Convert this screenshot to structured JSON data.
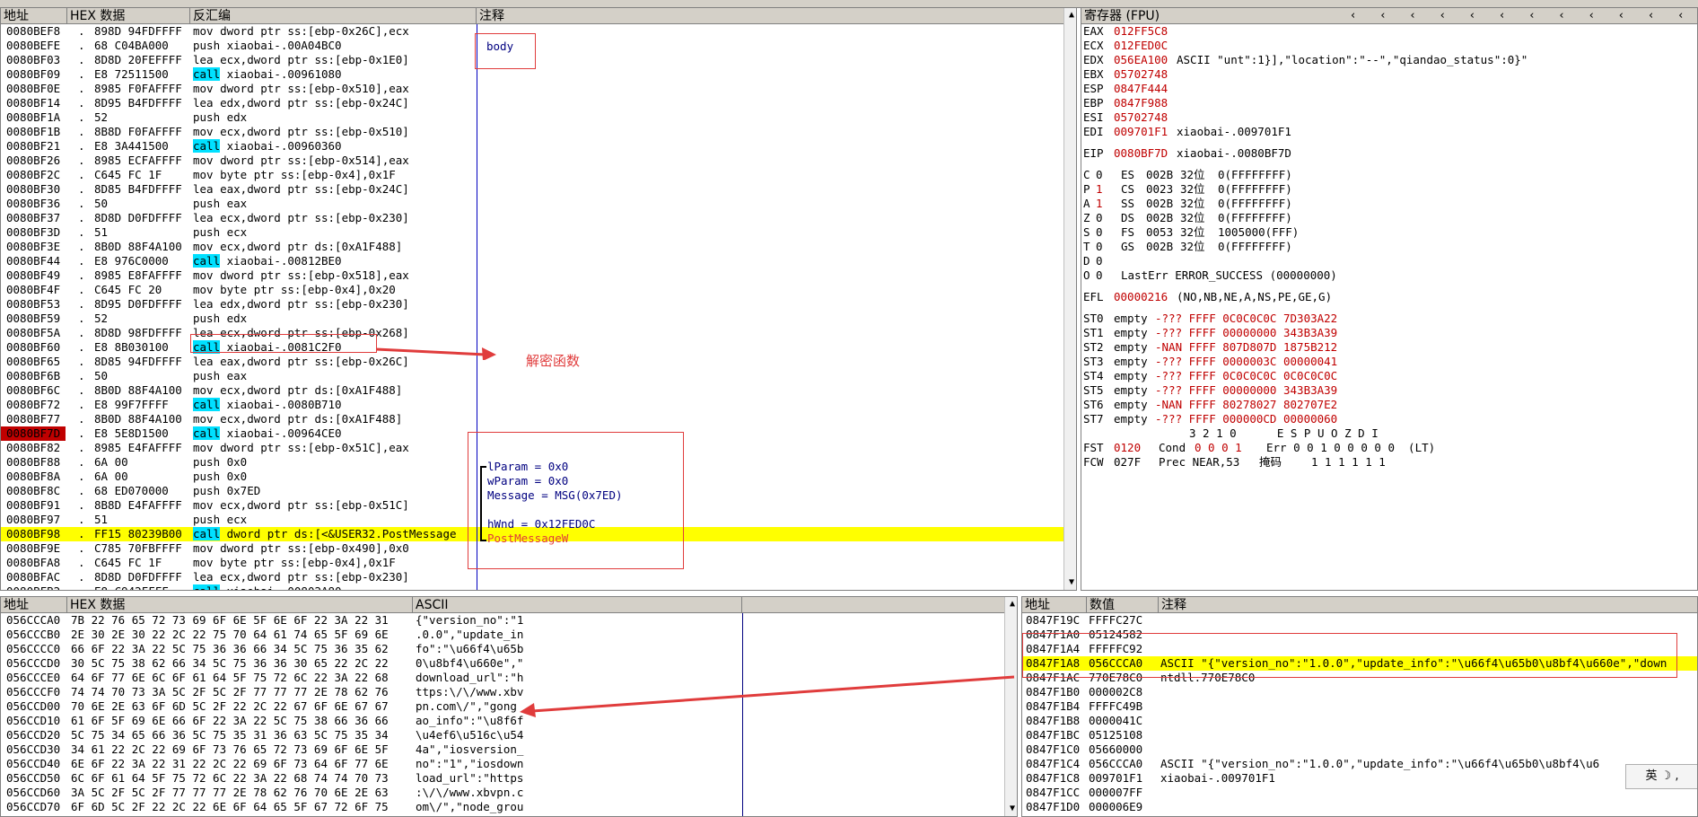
{
  "disasm": {
    "headers": {
      "addr": "地址",
      "hex": "HEX 数据",
      "asm": "反汇编",
      "comment": "注释"
    },
    "rows": [
      {
        "addr": "0080BEF8",
        "mark": ".",
        "hex": "898D 94FDFFFF",
        "asm": "mov dword ptr ss:[ebp-0x26C],ecx"
      },
      {
        "addr": "0080BEFE",
        "mark": ".",
        "hex": "68 C04BA000",
        "asm": "push xiaobai-.00A04BC0"
      },
      {
        "addr": "0080BF03",
        "mark": ".",
        "hex": "8D8D 20FEFFFF",
        "asm": "lea ecx,dword ptr ss:[ebp-0x1E0]"
      },
      {
        "addr": "0080BF09",
        "mark": ".",
        "hex": "E8 72511500",
        "asm": "call xiaobai-.00961080"
      },
      {
        "addr": "0080BF0E",
        "mark": ".",
        "hex": "8985 F0FAFFFF",
        "asm": "mov dword ptr ss:[ebp-0x510],eax"
      },
      {
        "addr": "0080BF14",
        "mark": ".",
        "hex": "8D95 B4FDFFFF",
        "asm": "lea edx,dword ptr ss:[ebp-0x24C]"
      },
      {
        "addr": "0080BF1A",
        "mark": ".",
        "hex": "52",
        "asm": "push edx"
      },
      {
        "addr": "0080BF1B",
        "mark": ".",
        "hex": "8B8D F0FAFFFF",
        "asm": "mov ecx,dword ptr ss:[ebp-0x510]"
      },
      {
        "addr": "0080BF21",
        "mark": ".",
        "hex": "E8 3A441500",
        "asm": "call xiaobai-.00960360"
      },
      {
        "addr": "0080BF26",
        "mark": ".",
        "hex": "8985 ECFAFFFF",
        "asm": "mov dword ptr ss:[ebp-0x514],eax"
      },
      {
        "addr": "0080BF2C",
        "mark": ".",
        "hex": "C645 FC 1F",
        "asm": "mov byte ptr ss:[ebp-0x4],0x1F"
      },
      {
        "addr": "0080BF30",
        "mark": ".",
        "hex": "8D85 B4FDFFFF",
        "asm": "lea eax,dword ptr ss:[ebp-0x24C]"
      },
      {
        "addr": "0080BF36",
        "mark": ".",
        "hex": "50",
        "asm": "push eax"
      },
      {
        "addr": "0080BF37",
        "mark": ".",
        "hex": "8D8D D0FDFFFF",
        "asm": "lea ecx,dword ptr ss:[ebp-0x230]"
      },
      {
        "addr": "0080BF3D",
        "mark": ".",
        "hex": "51",
        "asm": "push ecx"
      },
      {
        "addr": "0080BF3E",
        "mark": ".",
        "hex": "8B0D 88F4A100",
        "asm": "mov ecx,dword ptr ds:[0xA1F488]"
      },
      {
        "addr": "0080BF44",
        "mark": ".",
        "hex": "E8 976C0000",
        "asm": "call xiaobai-.00812BE0"
      },
      {
        "addr": "0080BF49",
        "mark": ".",
        "hex": "8985 E8FAFFFF",
        "asm": "mov dword ptr ss:[ebp-0x518],eax"
      },
      {
        "addr": "0080BF4F",
        "mark": ".",
        "hex": "C645 FC 20",
        "asm": "mov byte ptr ss:[ebp-0x4],0x20"
      },
      {
        "addr": "0080BF53",
        "mark": ".",
        "hex": "8D95 D0FDFFFF",
        "asm": "lea edx,dword ptr ss:[ebp-0x230]"
      },
      {
        "addr": "0080BF59",
        "mark": ".",
        "hex": "52",
        "asm": "push edx"
      },
      {
        "addr": "0080BF5A",
        "mark": ".",
        "hex": "8D8D 98FDFFFF",
        "asm": "lea ecx,dword ptr ss:[ebp-0x268]"
      },
      {
        "addr": "0080BF60",
        "mark": ".",
        "hex": "E8 8B030100",
        "asm": "call xiaobai-.0081C2F0"
      },
      {
        "addr": "0080BF65",
        "mark": ".",
        "hex": "8D85 94FDFFFF",
        "asm": "lea eax,dword ptr ss:[ebp-0x26C]"
      },
      {
        "addr": "0080BF6B",
        "mark": ".",
        "hex": "50",
        "asm": "push eax"
      },
      {
        "addr": "0080BF6C",
        "mark": ".",
        "hex": "8B0D 88F4A100",
        "asm": "mov ecx,dword ptr ds:[0xA1F488]"
      },
      {
        "addr": "0080BF72",
        "mark": ".",
        "hex": "E8 99F7FFFF",
        "asm": "call xiaobai-.0080B710"
      },
      {
        "addr": "0080BF77",
        "mark": ".",
        "hex": "8B0D 88F4A100",
        "asm": "mov ecx,dword ptr ds:[0xA1F488]"
      },
      {
        "addr": "0080BF7D",
        "mark": ".",
        "hex": "E8 5E8D1500",
        "asm": "call xiaobai-.00964CE0"
      },
      {
        "addr": "0080BF82",
        "mark": ".",
        "hex": "8985 E4FAFFFF",
        "asm": "mov dword ptr ss:[ebp-0x51C],eax"
      },
      {
        "addr": "0080BF88",
        "mark": ".",
        "hex": "6A 00",
        "asm": "push 0x0"
      },
      {
        "addr": "0080BF8A",
        "mark": ".",
        "hex": "6A 00",
        "asm": "push 0x0"
      },
      {
        "addr": "0080BF8C",
        "mark": ".",
        "hex": "68 ED070000",
        "asm": "push 0x7ED"
      },
      {
        "addr": "0080BF91",
        "mark": ".",
        "hex": "8B8D E4FAFFFF",
        "asm": "mov ecx,dword ptr ss:[ebp-0x51C]"
      },
      {
        "addr": "0080BF97",
        "mark": ".",
        "hex": "51",
        "asm": "push ecx"
      },
      {
        "addr": "0080BF98",
        "mark": ".",
        "hex": "FF15 80239B00",
        "asm": "call dword ptr ds:[<&USER32.PostMessage"
      },
      {
        "addr": "0080BF9E",
        "mark": ".",
        "hex": "C785 70FBFFFF",
        "asm": "mov dword ptr ss:[ebp-0x490],0x0"
      },
      {
        "addr": "0080BFA8",
        "mark": ".",
        "hex": "C645 FC 1F",
        "asm": "mov byte ptr ss:[ebp-0x4],0x1F"
      },
      {
        "addr": "0080BFAC",
        "mark": ".",
        "hex": "8D8D D0FDFFFF",
        "asm": "lea ecx,dword ptr ss:[ebp-0x230]"
      },
      {
        "addr": "0080BFB2",
        "mark": ".",
        "hex": "E8 C942FFFF",
        "asm": "call xiaobai-.00802A80"
      }
    ],
    "comments": {
      "body": "body",
      "lparam": "lParam = 0x0",
      "wparam": "wParam = 0x0",
      "message": "Message = MSG(0x7ED)",
      "hwnd": "hWnd = 0x12FED0C",
      "postmessage": "PostMessageW"
    },
    "annotation": "解密函数"
  },
  "registers": {
    "header": "寄存器 (FPU)",
    "gp": [
      {
        "name": "EAX",
        "val": "012FF5C8",
        "note": ""
      },
      {
        "name": "ECX",
        "val": "012FED0C",
        "note": ""
      },
      {
        "name": "EDX",
        "val": "056EA100",
        "note": "ASCII \"unt\":1}],\"location\":\"--\",\"qiandao_status\":0}\""
      },
      {
        "name": "EBX",
        "val": "05702748",
        "note": ""
      },
      {
        "name": "ESP",
        "val": "0847F444",
        "note": ""
      },
      {
        "name": "EBP",
        "val": "0847F988",
        "note": ""
      },
      {
        "name": "ESI",
        "val": "05702748",
        "note": ""
      },
      {
        "name": "EDI",
        "val": "009701F1",
        "note": "xiaobai-.009701F1"
      }
    ],
    "eip": {
      "name": "EIP",
      "val": "0080BF7D",
      "note": "xiaobai-.0080BF7D"
    },
    "flags": [
      {
        "f": "C",
        "v": "0",
        "seg": "ES",
        "sv": "002B",
        "bits": "32位",
        "rest": "0(FFFFFFFF)"
      },
      {
        "f": "P",
        "v": "1",
        "seg": "CS",
        "sv": "0023",
        "bits": "32位",
        "rest": "0(FFFFFFFF)"
      },
      {
        "f": "A",
        "v": "1",
        "seg": "SS",
        "sv": "002B",
        "bits": "32位",
        "rest": "0(FFFFFFFF)"
      },
      {
        "f": "Z",
        "v": "0",
        "seg": "DS",
        "sv": "002B",
        "bits": "32位",
        "rest": "0(FFFFFFFF)"
      },
      {
        "f": "S",
        "v": "0",
        "seg": "FS",
        "sv": "0053",
        "bits": "32位",
        "rest": "1005000(FFF)"
      },
      {
        "f": "T",
        "v": "0",
        "seg": "GS",
        "sv": "002B",
        "bits": "32位",
        "rest": "0(FFFFFFFF)"
      },
      {
        "f": "D",
        "v": "0",
        "seg": "",
        "sv": "",
        "bits": "",
        "rest": ""
      },
      {
        "f": "O",
        "v": "0",
        "seg": "",
        "sv": "",
        "bits": "",
        "rest": "LastErr ERROR_SUCCESS (00000000)"
      }
    ],
    "efl": {
      "name": "EFL",
      "val": "00000216",
      "note": "(NO,NB,NE,A,NS,PE,GE,G)"
    },
    "st": [
      {
        "name": "ST0",
        "tag": "empty",
        "v": "-??? FFFF 0C0C0C0C 7D303A22"
      },
      {
        "name": "ST1",
        "tag": "empty",
        "v": "-??? FFFF 00000000 343B3A39"
      },
      {
        "name": "ST2",
        "tag": "empty",
        "v": "-NAN FFFF 807D807D 1875B212"
      },
      {
        "name": "ST3",
        "tag": "empty",
        "v": "-??? FFFF 0000003C 00000041"
      },
      {
        "name": "ST4",
        "tag": "empty",
        "v": "-??? FFFF 0C0C0C0C 0C0C0C0C"
      },
      {
        "name": "ST5",
        "tag": "empty",
        "v": "-??? FFFF 00000000 343B3A39"
      },
      {
        "name": "ST6",
        "tag": "empty",
        "v": "-NAN FFFF 80278027 802707E2"
      },
      {
        "name": "ST7",
        "tag": "empty",
        "v": "-??? FFFF 000000CD 00000060"
      }
    ],
    "fbits": "3 2 1 0      E S P U O Z D I",
    "fst": {
      "name": "FST",
      "val": "0120",
      "cond_label": "Cond",
      "cond": "0 0 0 1",
      "err": "Err 0 0 1 0 0 0 0 0  (LT)"
    },
    "fcw": {
      "name": "FCW",
      "val": "027F",
      "prec": "Prec NEAR,53",
      "mask_label": "掩码",
      "mask": "1 1 1 1 1 1"
    }
  },
  "dump": {
    "headers": {
      "addr": "地址",
      "hex": "HEX 数据",
      "ascii": "ASCII"
    },
    "rows": [
      {
        "addr": "056CCCA0",
        "hex": "7B 22 76 65 72 73 69 6F 6E 5F 6E 6F 22 3A 22 31",
        "ascii": "{\"version_no\":\"1"
      },
      {
        "addr": "056CCCB0",
        "hex": "2E 30 2E 30 22 2C 22 75 70 64 61 74 65 5F 69 6E",
        "ascii": ".0.0\",\"update_in"
      },
      {
        "addr": "056CCCC0",
        "hex": "66 6F 22 3A 22 5C 75 36 36 66 34 5C 75 36 35 62",
        "ascii": "fo\":\"\\u66f4\\u65b"
      },
      {
        "addr": "056CCCD0",
        "hex": "30 5C 75 38 62 66 34 5C 75 36 36 30 65 22 2C 22",
        "ascii": "0\\u8bf4\\u660e\",\""
      },
      {
        "addr": "056CCCE0",
        "hex": "64 6F 77 6E 6C 6F 61 64 5F 75 72 6C 22 3A 22 68",
        "ascii": "download_url\":\"h"
      },
      {
        "addr": "056CCCF0",
        "hex": "74 74 70 73 3A 5C 2F 5C 2F 77 77 77 2E 78 62 76",
        "ascii": "ttps:\\/\\/www.xbv"
      },
      {
        "addr": "056CCD00",
        "hex": "70 6E 2E 63 6F 6D 5C 2F 22 2C 22 67 6F 6E 67 67",
        "ascii": "pn.com\\/\",\"gong"
      },
      {
        "addr": "056CCD10",
        "hex": "61 6F 5F 69 6E 66 6F 22 3A 22 5C 75 38 66 36 66",
        "ascii": "ao_info\":\"\\u8f6f"
      },
      {
        "addr": "056CCD20",
        "hex": "5C 75 34 65 66 36 5C 75 35 31 36 63 5C 75 35 34",
        "ascii": "\\u4ef6\\u516c\\u54"
      },
      {
        "addr": "056CCD30",
        "hex": "34 61 22 2C 22 69 6F 73 76 65 72 73 69 6F 6E 5F",
        "ascii": "4a\",\"iosversion_"
      },
      {
        "addr": "056CCD40",
        "hex": "6E 6F 22 3A 22 31 22 2C 22 69 6F 73 64 6F 77 6E",
        "ascii": "no\":\"1\",\"iosdown"
      },
      {
        "addr": "056CCD50",
        "hex": "6C 6F 61 64 5F 75 72 6C 22 3A 22 68 74 74 70 73",
        "ascii": "load_url\":\"https"
      },
      {
        "addr": "056CCD60",
        "hex": "3A 5C 2F 5C 2F 77 77 77 2E 78 62 76 70 6E 2E 63",
        "ascii": ":\\/\\/www.xbvpn.c"
      },
      {
        "addr": "056CCD70",
        "hex": "6F 6D 5C 2F 22 2C 22 6E 6F 64 65 5F 67 72 6F 75",
        "ascii": "om\\/\",\"node_grou"
      }
    ]
  },
  "stack": {
    "headers": {
      "addr": "地址",
      "val": "数值",
      "comment": "注释"
    },
    "rows": [
      {
        "addr": "0847F19C",
        "val": "FFFFC27C",
        "c": ""
      },
      {
        "addr": "0847F1A0",
        "val": "05124582",
        "c": ""
      },
      {
        "addr": "0847F1A4",
        "val": "FFFFFC92",
        "c": ""
      },
      {
        "addr": "0847F1A8",
        "val": "056CCCA0",
        "c": "ASCII \"{\"version_no\":\"1.0.0\",\"update_info\":\"\\u66f4\\u65b0\\u8bf4\\u660e\",\"down"
      },
      {
        "addr": "0847F1AC",
        "val": "770E78C0",
        "c": "ntdll.770E78C0"
      },
      {
        "addr": "0847F1B0",
        "val": "000002C8",
        "c": ""
      },
      {
        "addr": "0847F1B4",
        "val": "FFFFC49B",
        "c": ""
      },
      {
        "addr": "0847F1B8",
        "val": "0000041C",
        "c": ""
      },
      {
        "addr": "0847F1BC",
        "val": "05125108",
        "c": ""
      },
      {
        "addr": "0847F1C0",
        "val": "05660000",
        "c": ""
      },
      {
        "addr": "0847F1C4",
        "val": "056CCCA0",
        "c": "ASCII \"{\"version_no\":\"1.0.0\",\"update_info\":\"\\u66f4\\u65b0\\u8bf4\\u6"
      },
      {
        "addr": "0847F1C8",
        "val": "009701F1",
        "c": "xiaobai-.009701F1"
      },
      {
        "addr": "0847F1CC",
        "val": "000007FF",
        "c": ""
      },
      {
        "addr": "0847F1D0",
        "val": "000006E9",
        "c": ""
      }
    ]
  },
  "ime": "英 ☽ ,"
}
